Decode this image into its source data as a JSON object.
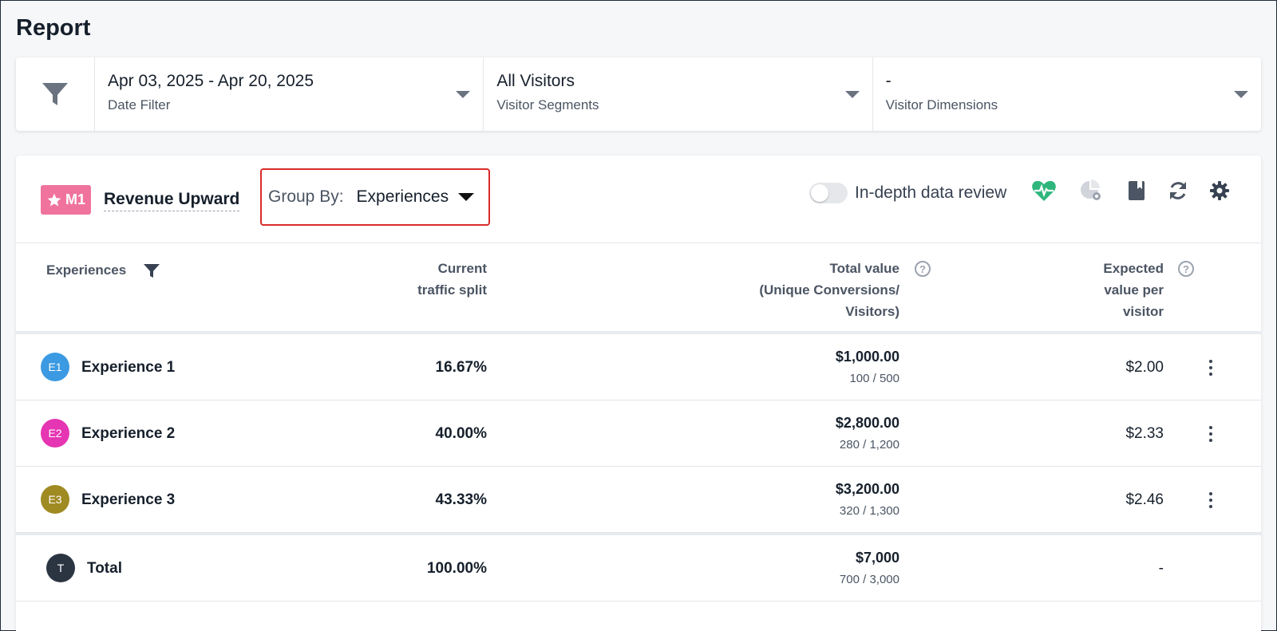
{
  "page": {
    "title": "Report"
  },
  "filters": [
    {
      "value": "Apr 03, 2025 - Apr 20, 2025",
      "label": "Date Filter"
    },
    {
      "value": "All Visitors",
      "label": "Visitor Segments"
    },
    {
      "value": "-",
      "label": "Visitor Dimensions"
    }
  ],
  "toolbar": {
    "metric_badge": "M1",
    "metric_name": "Revenue Upward",
    "group_by_label": "Group By:",
    "group_by_value": "Experiences",
    "toggle_label": "In-depth data review",
    "toggle_on": false
  },
  "table": {
    "columns": {
      "experiences": "Experiences",
      "split_line1": "Current",
      "split_line2": "traffic split",
      "total_line1": "Total value",
      "total_line2": "(Unique Conversions/",
      "total_line3": "Visitors)",
      "expected_line1": "Expected",
      "expected_line2": "value per",
      "expected_line3": "visitor"
    },
    "rows": [
      {
        "avatar": "E1",
        "avatar_color": "#3b9ae1",
        "name": "Experience 1",
        "split": "16.67%",
        "total": "$1,000.00",
        "conversions": "100 / 500",
        "expected": "$2.00"
      },
      {
        "avatar": "E2",
        "avatar_color": "#e535b3",
        "name": "Experience 2",
        "split": "40.00%",
        "total": "$2,800.00",
        "conversions": "280 / 1,200",
        "expected": "$2.33"
      },
      {
        "avatar": "E3",
        "avatar_color": "#a08a22",
        "name": "Experience 3",
        "split": "43.33%",
        "total": "$3,200.00",
        "conversions": "320 / 1,300",
        "expected": "$2.46"
      }
    ],
    "total": {
      "avatar": "T",
      "avatar_color": "#2b3542",
      "name": "Total",
      "split": "100.00%",
      "total": "$7,000",
      "conversions": "700 / 3,000",
      "expected": "-"
    }
  },
  "colors": {
    "accent_badge": "#f0739d",
    "highlight_border": "#d92b2b",
    "health_icon": "#2fb67c"
  }
}
